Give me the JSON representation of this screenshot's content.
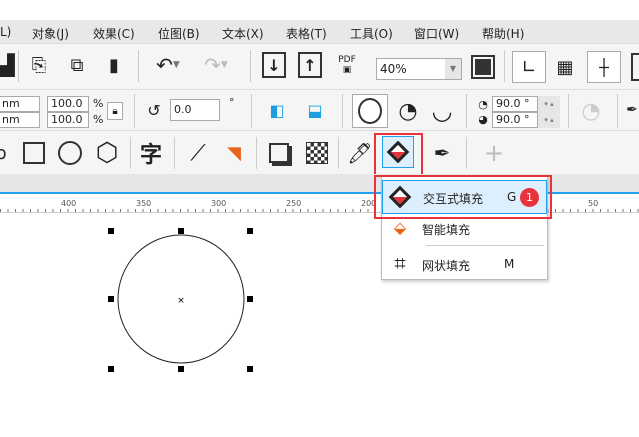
{
  "menu": [
    "L)",
    "对象(J)",
    "效果(C)",
    "位图(B)",
    "文本(X)",
    "表格(T)",
    "工具(O)",
    "窗口(W)",
    "帮助(H)"
  ],
  "toolbar": {
    "zoom_value": "40%",
    "pdf_label": "PDF"
  },
  "properties": {
    "width_unit": "nm",
    "height_unit": "nm",
    "scale_x": "100.0",
    "scale_y": "100.0",
    "percent": "%",
    "rotation": "0.0",
    "degree": "°",
    "start_angle": "90.0 °",
    "end_angle": "90.0 °"
  },
  "toolbox": {
    "text_tool": "字",
    "add": "+"
  },
  "ruler": {
    "ticks": [
      "400",
      "350",
      "300",
      "250",
      "200",
      "50"
    ]
  },
  "dropdown": {
    "items": [
      {
        "label": "交互式填充",
        "shortcut": "G",
        "badge": "1"
      },
      {
        "label": "智能填充",
        "shortcut": ""
      },
      {
        "label": "网状填充",
        "shortcut": "M"
      }
    ]
  },
  "colors": {
    "highlight": "#e8323c",
    "accent": "#1ea1f2",
    "selected_bg": "#ddeefc"
  }
}
